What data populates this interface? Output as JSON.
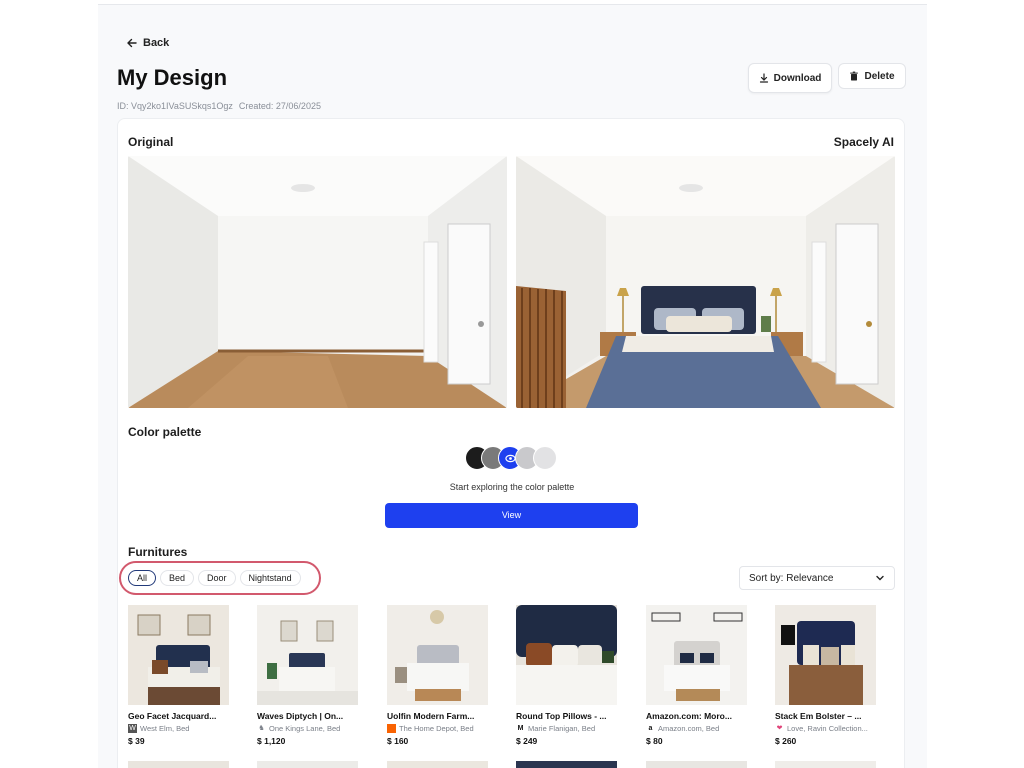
{
  "header": {
    "back_label": "Back",
    "title": "My Design",
    "id_text": "ID: Vqy2ko1IVaSUSkqs1Ogz",
    "created_text": "Created: 27/06/2025",
    "download_label": "Download",
    "delete_label": "Delete"
  },
  "comparison": {
    "original_label": "Original",
    "ai_label": "Spacely AI"
  },
  "palette": {
    "title": "Color palette",
    "swatches": [
      "#1c1c1c",
      "#7a7a7a",
      "#1e40ef",
      "#c9c9cc",
      "#e2e2e4"
    ],
    "explore_text": "Start exploring the color palette",
    "view_label": "View"
  },
  "furnitures": {
    "title": "Furnitures",
    "filters": [
      "All",
      "Bed",
      "Door",
      "Nightstand"
    ],
    "sort_label": "Sort by: Relevance",
    "items": [
      {
        "name": "Geo Facet Jacquard...",
        "source": "West Elm, Bed",
        "price": "$ 39",
        "icon": "west-elm-icon"
      },
      {
        "name": "Waves Diptych | On...",
        "source": "One Kings Lane, Bed",
        "price": "$ 1,120",
        "icon": "one-kings-lane-icon"
      },
      {
        "name": "Uolfin Modern Farm...",
        "source": "The Home Depot, Bed",
        "price": "$ 160",
        "icon": "home-depot-icon"
      },
      {
        "name": "Round Top Pillows - ...",
        "source": "Marie Flanigan, Bed",
        "price": "$ 249",
        "icon": "marie-flanigan-icon"
      },
      {
        "name": "Amazon.com: Moro...",
        "source": "Amazon.com, Bed",
        "price": "$ 80",
        "icon": "amazon-icon"
      },
      {
        "name": "Stack Em Bolster – ...",
        "source": "Love, Ravin Collection...",
        "price": "$ 260",
        "icon": "heart-icon"
      }
    ]
  }
}
